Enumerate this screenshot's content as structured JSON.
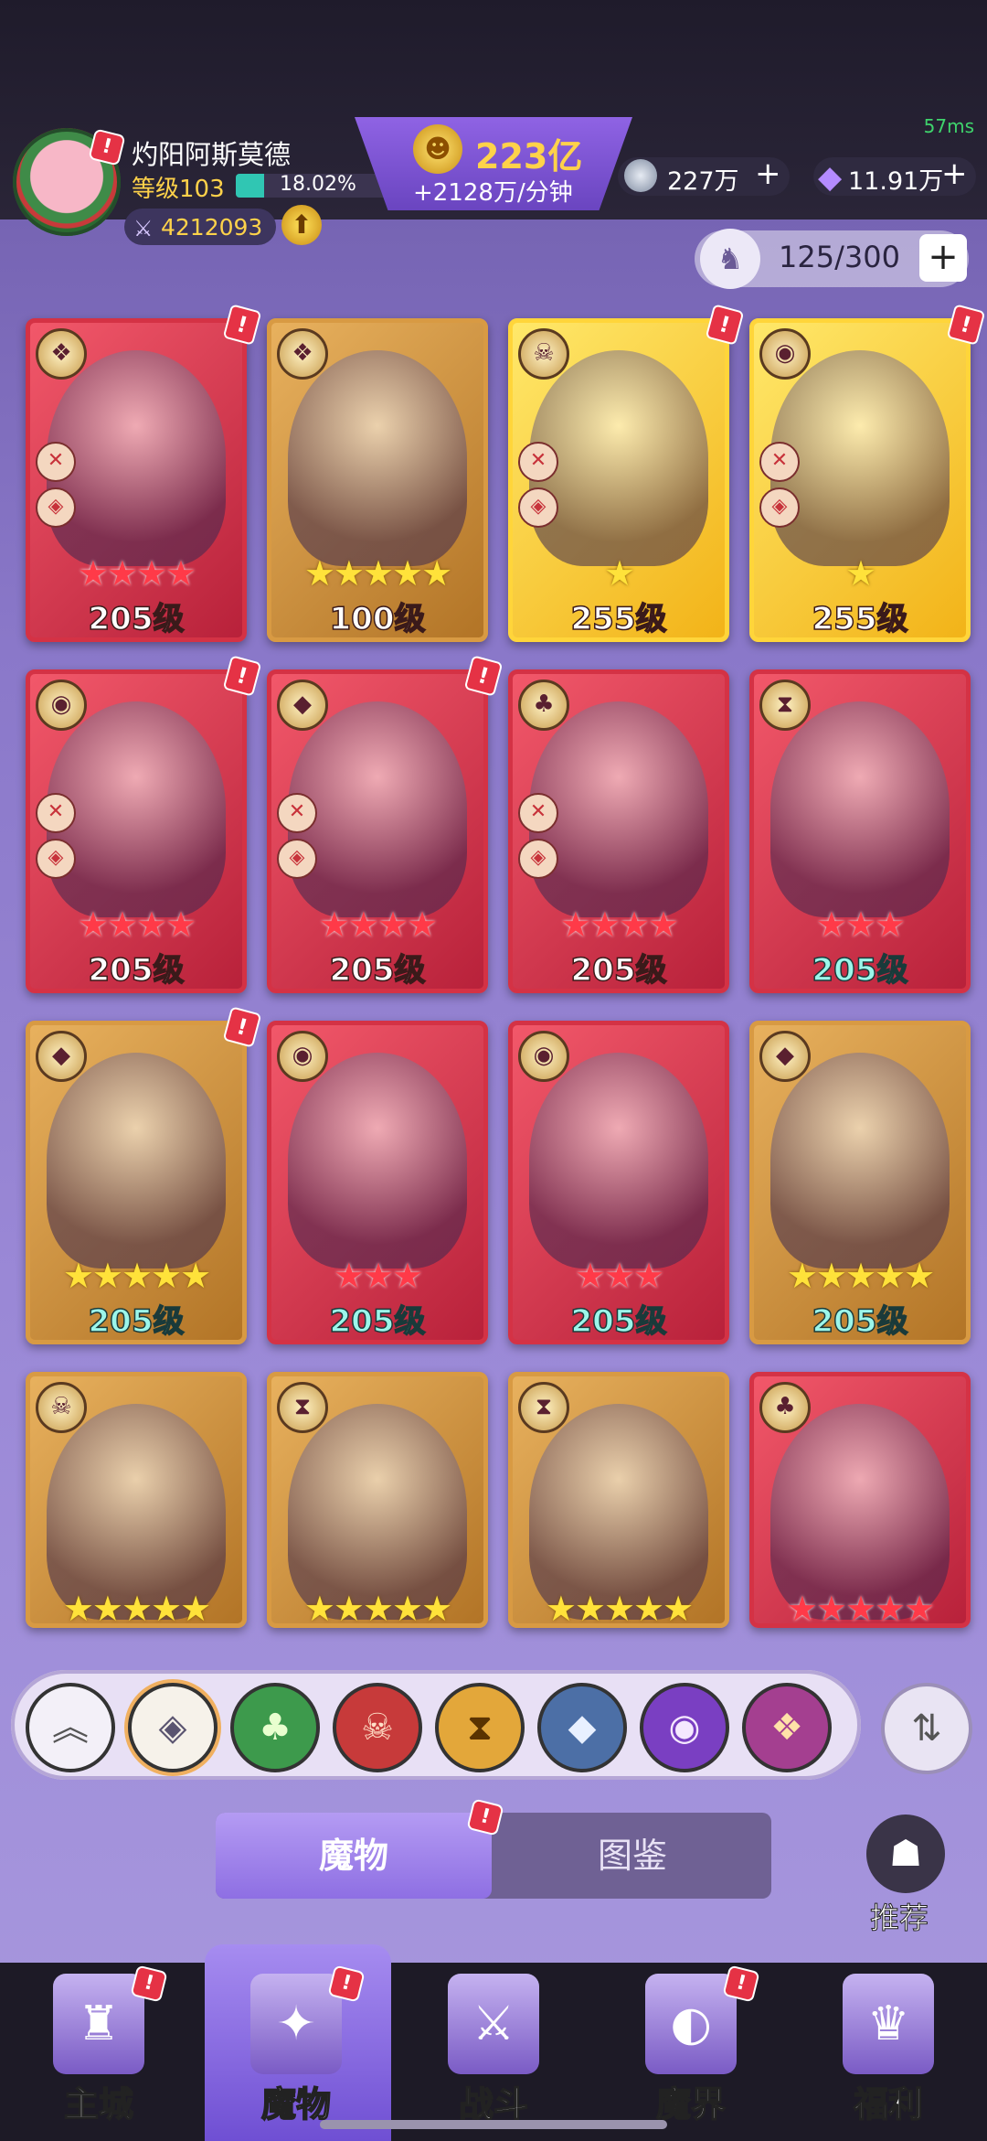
{
  "header": {
    "ping": "57ms",
    "player_name": "灼阳阿斯莫德",
    "level_label": "等级103",
    "xp_percent": "18.02%",
    "xp_fraction": 0.1802,
    "power": "4212093",
    "gold": "223亿",
    "gold_rate": "+2128万/分钟",
    "silver": "227万",
    "gems": "11.91万",
    "plus": "+",
    "alert": "!"
  },
  "roster": {
    "count": "125/300"
  },
  "cards": [
    {
      "level": "205级",
      "stars": "★★★★",
      "star_color": "red",
      "frame": "red",
      "level_color": "white",
      "faction_icon": "chaos-icon",
      "faction_glyph": "❖",
      "badges": [
        "✕",
        "◈"
      ],
      "alert": true
    },
    {
      "level": "100级",
      "stars": "★★★★★",
      "star_color": "yellow",
      "frame": "gold",
      "level_color": "white",
      "faction_icon": "chaos-icon",
      "faction_glyph": "❖",
      "badges": [],
      "alert": false
    },
    {
      "level": "255级",
      "stars": "★",
      "star_color": "yellow",
      "frame": "yellow",
      "level_color": "white",
      "faction_icon": "demon-icon",
      "faction_glyph": "☠",
      "badges": [
        "✕",
        "◈"
      ],
      "alert": true
    },
    {
      "level": "255级",
      "stars": "★",
      "star_color": "yellow",
      "frame": "yellow",
      "level_color": "white",
      "faction_icon": "eye-icon",
      "faction_glyph": "◉",
      "badges": [
        "✕",
        "◈"
      ],
      "alert": true
    },
    {
      "level": "205级",
      "stars": "★★★★",
      "star_color": "red",
      "frame": "red",
      "level_color": "white",
      "faction_icon": "eye-icon",
      "faction_glyph": "◉",
      "badges": [
        "✕",
        "◈"
      ],
      "alert": true
    },
    {
      "level": "205级",
      "stars": "★★★★",
      "star_color": "red",
      "frame": "red",
      "level_color": "white",
      "faction_icon": "dragon-icon",
      "faction_glyph": "◆",
      "badges": [
        "✕",
        "◈"
      ],
      "alert": true
    },
    {
      "level": "205级",
      "stars": "★★★★",
      "star_color": "red",
      "frame": "red",
      "level_color": "white",
      "faction_icon": "leaf-icon",
      "faction_glyph": "♣",
      "badges": [
        "✕",
        "◈"
      ],
      "alert": false
    },
    {
      "level": "205级",
      "stars": "★★★",
      "star_color": "red",
      "frame": "red",
      "level_color": "teal",
      "faction_icon": "hourglass-icon",
      "faction_glyph": "⧗",
      "badges": [],
      "alert": false
    },
    {
      "level": "205级",
      "stars": "★★★★★",
      "star_color": "yellow",
      "frame": "gold",
      "level_color": "teal",
      "faction_icon": "dragon-icon",
      "faction_glyph": "◆",
      "badges": [],
      "alert": true
    },
    {
      "level": "205级",
      "stars": "★★★",
      "star_color": "red",
      "frame": "red",
      "level_color": "teal",
      "faction_icon": "eye-icon",
      "faction_glyph": "◉",
      "badges": [],
      "alert": false
    },
    {
      "level": "205级",
      "stars": "★★★",
      "star_color": "red",
      "frame": "red",
      "level_color": "teal",
      "faction_icon": "eye-icon",
      "faction_glyph": "◉",
      "badges": [],
      "alert": false
    },
    {
      "level": "205级",
      "stars": "★★★★★",
      "star_color": "yellow",
      "frame": "gold",
      "level_color": "teal",
      "faction_icon": "dragon-icon",
      "faction_glyph": "◆",
      "badges": [],
      "alert": false
    },
    {
      "level": "",
      "stars": "★★★★★",
      "star_color": "yellow",
      "frame": "gold",
      "level_color": "white",
      "faction_icon": "demon-icon",
      "faction_glyph": "☠",
      "badges": [],
      "alert": false
    },
    {
      "level": "",
      "stars": "★★★★★",
      "star_color": "yellow",
      "frame": "gold",
      "level_color": "white",
      "faction_icon": "hourglass-icon",
      "faction_glyph": "⧗",
      "badges": [],
      "alert": false
    },
    {
      "level": "",
      "stars": "★★★★★",
      "star_color": "yellow",
      "frame": "gold",
      "level_color": "white",
      "faction_icon": "hourglass-icon",
      "faction_glyph": "⧗",
      "badges": [],
      "alert": false
    },
    {
      "level": "",
      "stars": "★★★★★",
      "star_color": "red",
      "frame": "red",
      "level_color": "white",
      "faction_icon": "leaf-icon",
      "faction_glyph": "♣",
      "badges": [],
      "alert": false
    }
  ],
  "filters": [
    {
      "icon": "collapse-icon",
      "glyph": "︽",
      "bg": "#f3f0f8",
      "fg": "#555555"
    },
    {
      "icon": "all-factions-icon",
      "glyph": "◈",
      "bg": "#f6f2ea",
      "fg": "#5a5470"
    },
    {
      "icon": "leaf-icon",
      "glyph": "♣",
      "bg": "#3d9a4c",
      "fg": "#e9ffcf"
    },
    {
      "icon": "demon-icon",
      "glyph": "☠",
      "bg": "#c73a3a",
      "fg": "#ffe0c8"
    },
    {
      "icon": "hourglass-icon",
      "glyph": "⧗",
      "bg": "#e3a73a",
      "fg": "#5a3300"
    },
    {
      "icon": "dragon-icon",
      "glyph": "◆",
      "bg": "#4c6fa6",
      "fg": "#e8f0ff"
    },
    {
      "icon": "eye-icon",
      "glyph": "◉",
      "bg": "#7a3fc2",
      "fg": "#f5e8ff"
    },
    {
      "icon": "chaos-icon",
      "glyph": "❖",
      "bg": "#a43f90",
      "fg": "#ffe2a8"
    }
  ],
  "tabs": {
    "monster": "魔物",
    "dex": "图鉴"
  },
  "recommend": {
    "label": "推荐"
  },
  "nav": [
    {
      "label": "主城",
      "icon": "castle-icon",
      "glyph": "♜",
      "alert": true
    },
    {
      "label": "魔物",
      "icon": "monster-flame-icon",
      "glyph": "✦",
      "alert": true
    },
    {
      "label": "战斗",
      "icon": "sword-shield-icon",
      "glyph": "⚔",
      "alert": false
    },
    {
      "label": "魔界",
      "icon": "portal-icon",
      "glyph": "◐",
      "alert": true
    },
    {
      "label": "福利",
      "icon": "treasure-chest-icon",
      "glyph": "♛",
      "alert": false
    }
  ]
}
